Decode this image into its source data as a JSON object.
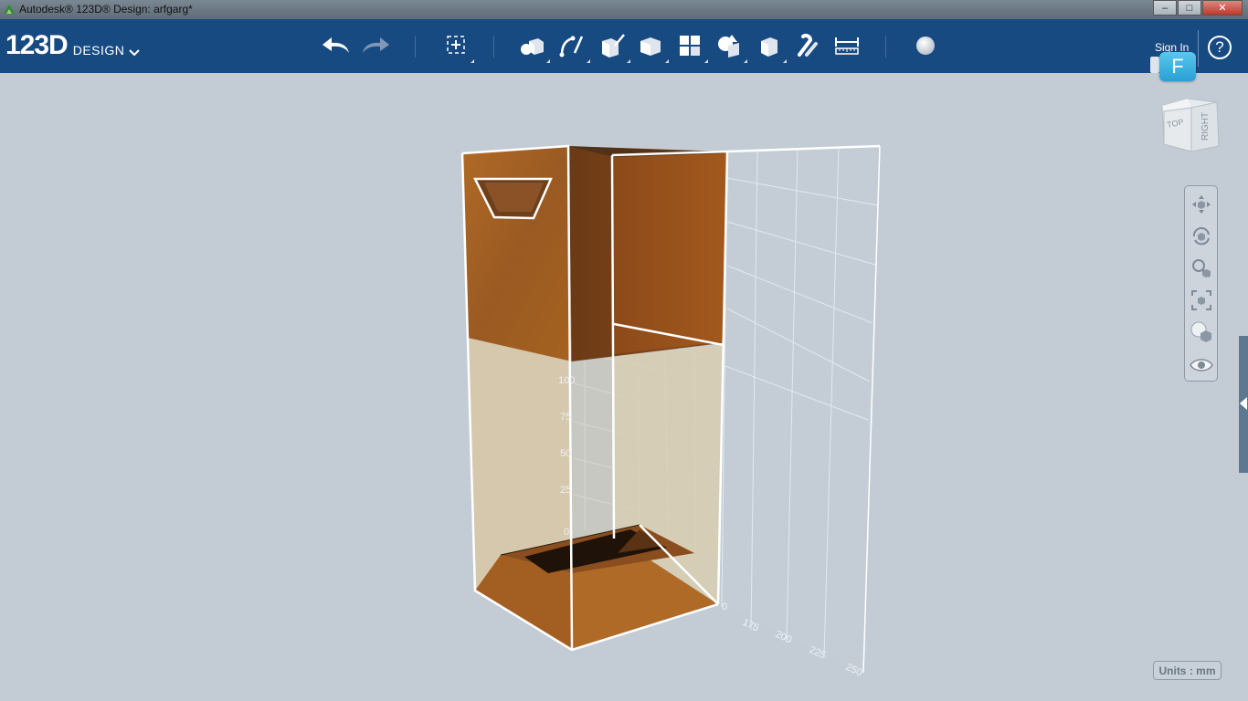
{
  "window": {
    "title": "Autodesk® 123D® Design: arfgarg*",
    "minimize": "–",
    "maximize": "□",
    "close": "✕"
  },
  "toolbar": {
    "logo_main": "123D",
    "logo_sub": "DESIGN",
    "tools": [
      {
        "name": "undo-icon"
      },
      {
        "name": "redo-icon"
      },
      {
        "name": "transform-icon"
      },
      {
        "name": "primitives-icon"
      },
      {
        "name": "sketch-icon"
      },
      {
        "name": "construct-icon"
      },
      {
        "name": "modify-icon"
      },
      {
        "name": "pattern-icon"
      },
      {
        "name": "grouping-icon"
      },
      {
        "name": "combine-icon"
      },
      {
        "name": "snap-icon"
      },
      {
        "name": "measure-icon"
      },
      {
        "name": "material-icon"
      }
    ],
    "sign_in": "Sign In",
    "help": "?"
  },
  "badge": {
    "letter": "F"
  },
  "viewcube": {
    "top": "TOP",
    "right": "RIGHT"
  },
  "nav": {
    "items": [
      "pan-icon",
      "orbit-icon",
      "zoom-icon",
      "fit-icon",
      "material-view-icon",
      "visibility-icon"
    ]
  },
  "grid": {
    "side_labels": [
      "100",
      "75",
      "50",
      "25",
      "0"
    ],
    "bottom_labels": [
      "0",
      "175",
      "200",
      "225",
      "250"
    ]
  },
  "status": {
    "units": "Units : mm"
  },
  "colors": {
    "toolbar": "#184a82",
    "viewport": "#c3ccd5",
    "accent": "#2b9fd4"
  }
}
